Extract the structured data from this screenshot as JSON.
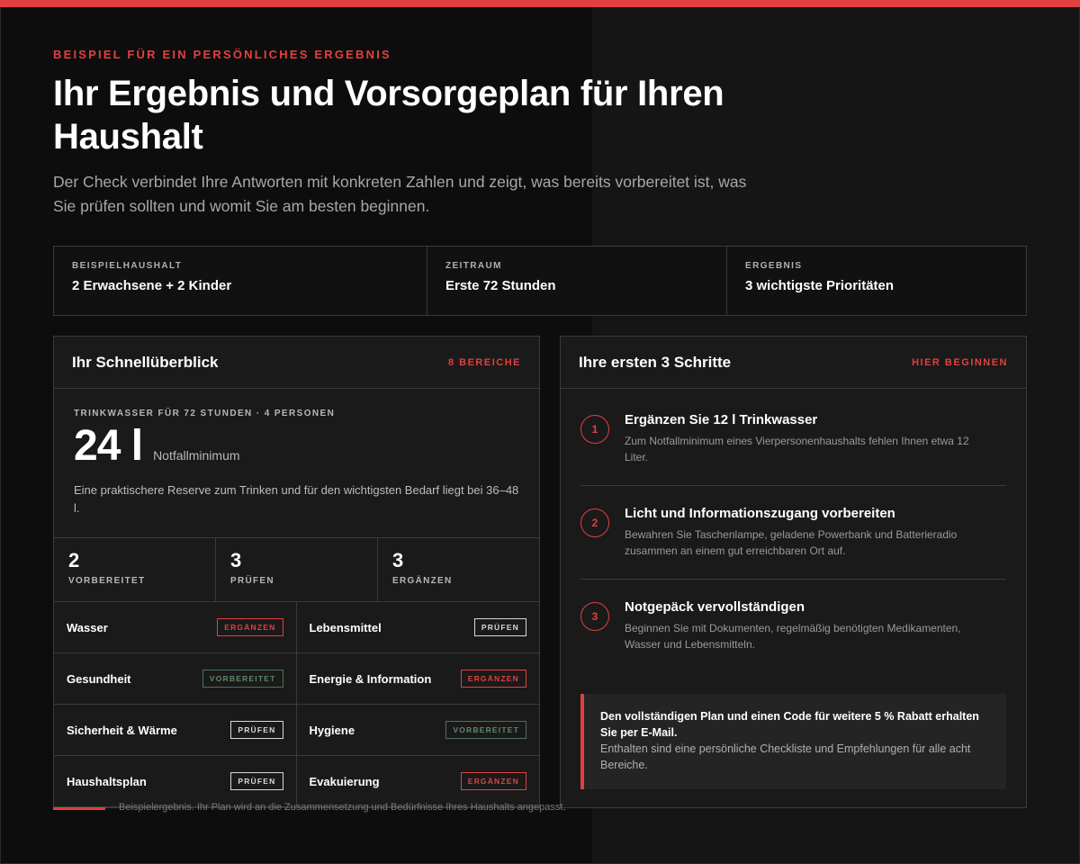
{
  "eyebrow": "BEISPIEL FÜR EIN PERSÖNLICHES ERGEBNIS",
  "title": "Ihr Ergebnis und Vorsorgeplan für Ihren Haushalt",
  "lead": "Der Check verbindet Ihre Antworten mit konkreten Zahlen und zeigt, was bereits vorbereitet ist, was Sie prüfen sollten und womit Sie am besten beginnen.",
  "facts": [
    {
      "label": "BEISPIELHAUSHALT",
      "value": "2 Erwachsene + 2 Kinder"
    },
    {
      "label": "ZEITRAUM",
      "value": "Erste 72 Stunden"
    },
    {
      "label": "ERGEBNIS",
      "value": "3 wichtigste Prioritäten"
    }
  ],
  "overview": {
    "title": "Ihr Schnellüberblick",
    "link": "8 BEREICHE",
    "water_label": "TRINKWASSER FÜR 72 STUNDEN · 4 PERSONEN",
    "water_value": "24 l",
    "water_unit": "Notfallminimum",
    "water_note": "Eine praktischere Reserve zum Trinken und für den wichtigsten Bedarf liegt bei 36–48 l.",
    "counts": [
      {
        "num": "2",
        "label": "VORBEREITET"
      },
      {
        "num": "3",
        "label": "PRÜFEN"
      },
      {
        "num": "3",
        "label": "ERGÄNZEN"
      }
    ],
    "areas": [
      {
        "name": "Wasser",
        "status": "ERGÄNZEN"
      },
      {
        "name": "Lebensmittel",
        "status": "PRÜFEN"
      },
      {
        "name": "Gesundheit",
        "status": "VORBEREITET"
      },
      {
        "name": "Energie & Information",
        "status": "ERGÄNZEN"
      },
      {
        "name": "Sicherheit & Wärme",
        "status": "PRÜFEN"
      },
      {
        "name": "Hygiene",
        "status": "VORBEREITET"
      },
      {
        "name": "Haushaltsplan",
        "status": "PRÜFEN"
      },
      {
        "name": "Evakuierung",
        "status": "ERGÄNZEN"
      }
    ]
  },
  "steps_panel": {
    "title": "Ihre ersten 3 Schritte",
    "link": "HIER BEGINNEN",
    "steps": [
      {
        "num": "1",
        "title": "Ergänzen Sie 12 l Trinkwasser",
        "text": "Zum Notfallminimum eines Vierpersonenhaushalts fehlen Ihnen etwa 12 Liter."
      },
      {
        "num": "2",
        "title": "Licht und Informationszugang vorbereiten",
        "text": "Bewahren Sie Taschenlampe, geladene Powerbank und Batterieradio zusammen an einem gut erreichbaren Ort auf."
      },
      {
        "num": "3",
        "title": "Notgepäck vervollständigen",
        "text": "Beginnen Sie mit Dokumenten, regelmäßig benötigten Medikamenten, Wasser und Lebensmitteln."
      }
    ],
    "cta_title": "Den vollständigen Plan und einen Code für weitere 5 % Rabatt erhalten Sie per E-Mail.",
    "cta_text": "Enthalten sind eine persönliche Checkliste und Empfehlungen für alle acht Bereiche."
  },
  "footer": "Beispielergebnis. Ihr Plan wird an die Zusammensetzung und Bedürfnisse Ihres Haushalts angepasst.",
  "colors": {
    "accent": "#e2403f",
    "prepared": "#5f8a6a",
    "background": "#0d0d0d"
  }
}
